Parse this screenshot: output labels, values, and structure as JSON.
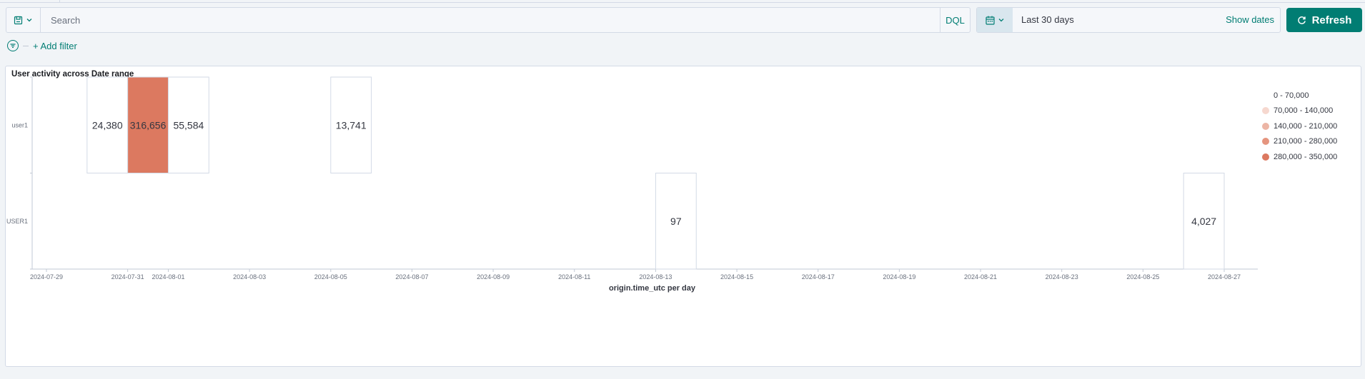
{
  "query": {
    "search_placeholder": "Search",
    "search_value": "",
    "language_label": "DQL"
  },
  "date_picker": {
    "range_label": "Last 30 days",
    "show_dates_label": "Show dates"
  },
  "refresh_label": "Refresh",
  "filters": {
    "add_filter_label": "+ Add filter"
  },
  "panel": {
    "title": "User activity across Date range"
  },
  "colors": {
    "accent": "#017d73",
    "empty_cell": "#ffffff",
    "cell_border": "#d3dae6"
  },
  "chart_data": {
    "type": "heatmap",
    "title": "User activity across Date range",
    "xlabel": "origin.time_utc per day",
    "ylabel": "",
    "x_ticks": [
      "2024-07-29",
      "2024-07-31",
      "2024-08-01",
      "2024-08-03",
      "2024-08-05",
      "2024-08-07",
      "2024-08-09",
      "2024-08-11",
      "2024-08-13",
      "2024-08-15",
      "2024-08-17",
      "2024-08-19",
      "2024-08-21",
      "2024-08-23",
      "2024-08-25",
      "2024-08-27"
    ],
    "x_domain": [
      "2024-07-29",
      "2024-08-27"
    ],
    "y_categories": [
      "user1",
      "USER1"
    ],
    "cells": [
      {
        "y": "user1",
        "date": "2024-07-30",
        "value": 24380,
        "label": "24,380"
      },
      {
        "y": "user1",
        "date": "2024-07-31",
        "value": 316656,
        "label": "316,656"
      },
      {
        "y": "user1",
        "date": "2024-08-01",
        "value": 55584,
        "label": "55,584"
      },
      {
        "y": "user1",
        "date": "2024-08-05",
        "value": 13741,
        "label": "13,741"
      },
      {
        "y": "USER1",
        "date": "2024-08-13",
        "value": 97,
        "label": "97"
      },
      {
        "y": "USER1",
        "date": "2024-08-26",
        "value": 4027,
        "label": "4,027"
      }
    ],
    "legend": [
      {
        "label": "0 - 70,000",
        "from": 0,
        "to": 70000,
        "color": "#ffffff"
      },
      {
        "label": "70,000 - 140,000",
        "from": 70000,
        "to": 140000,
        "color": "#f6d8cf"
      },
      {
        "label": "140,000 - 210,000",
        "from": 140000,
        "to": 210000,
        "color": "#ecb5a5"
      },
      {
        "label": "210,000 - 280,000",
        "from": 210000,
        "to": 280000,
        "color": "#e5957f"
      },
      {
        "label": "280,000 - 350,000",
        "from": 280000,
        "to": 350000,
        "color": "#dc7960"
      }
    ],
    "legend_position": "right",
    "grid": false
  }
}
